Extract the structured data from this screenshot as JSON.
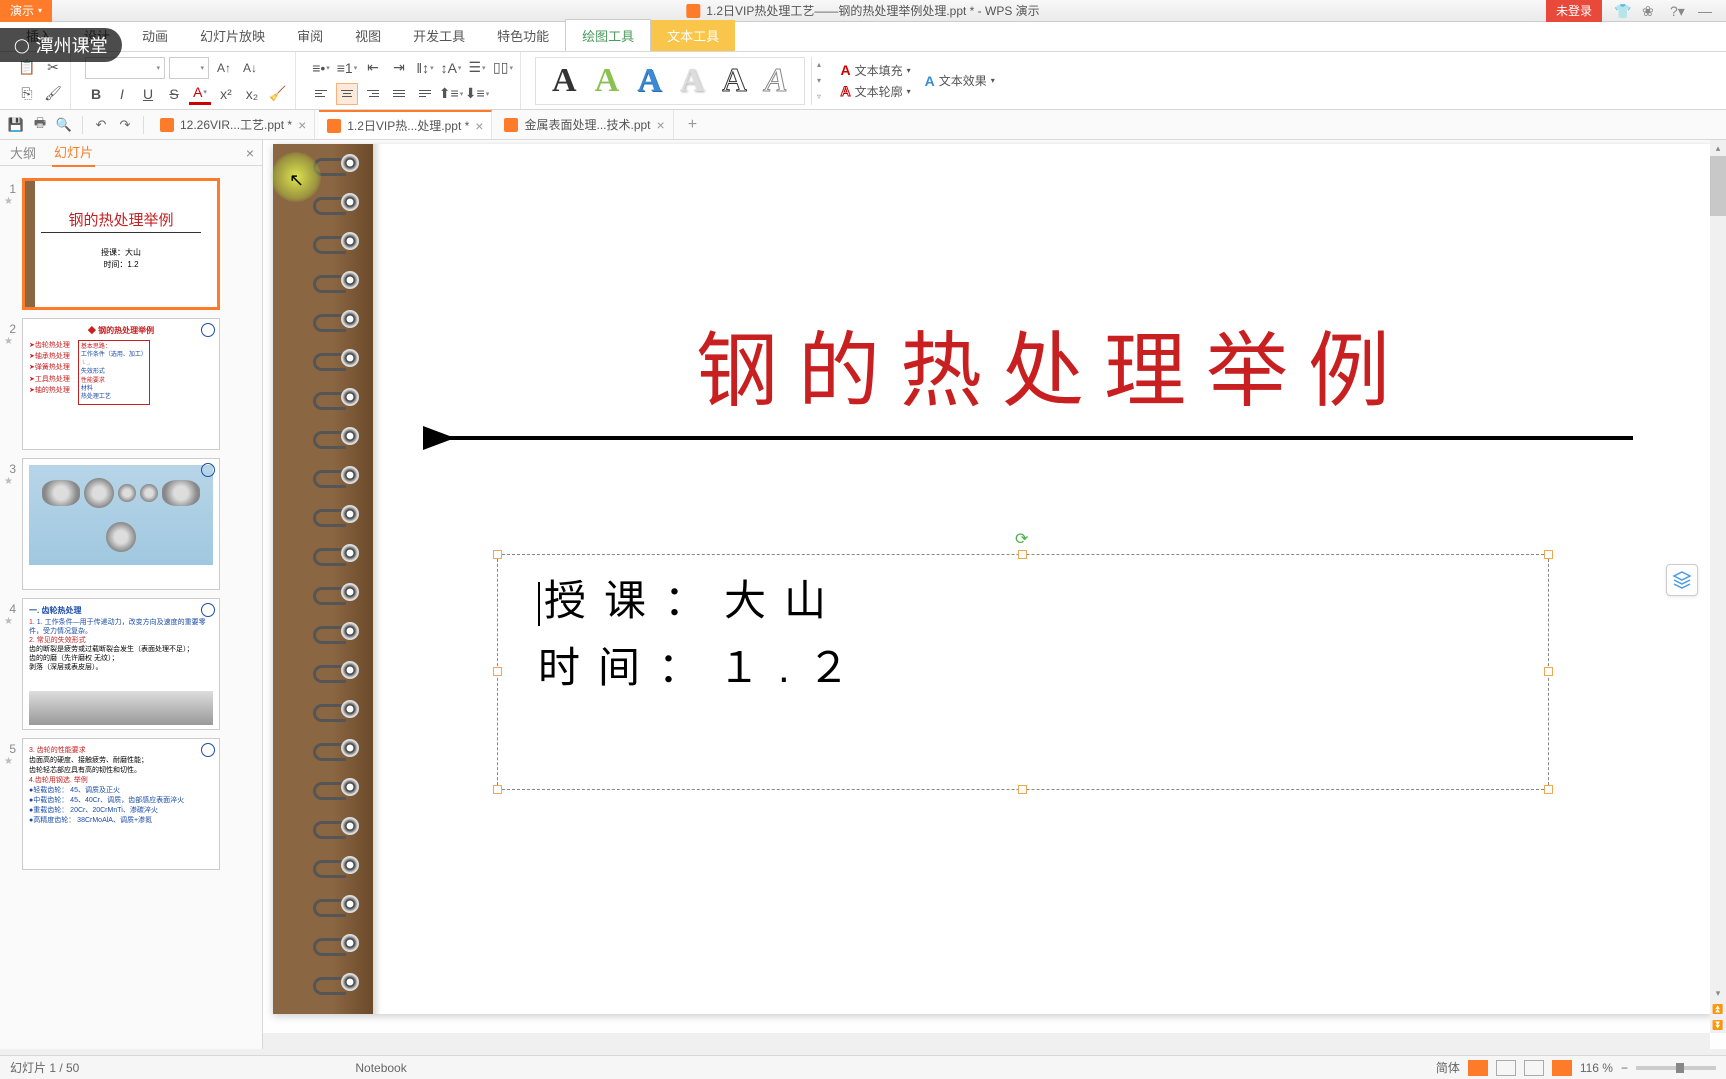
{
  "title_bar": {
    "app_label": "演示",
    "doc_title": "1.2日VIP热处理工艺——钢的热处理举例处理.ppt * - WPS 演示",
    "login_label": "未登录"
  },
  "menu": {
    "items": [
      "插入",
      "设计",
      "动画",
      "幻灯片放映",
      "审阅",
      "视图",
      "开发工具",
      "特色功能"
    ],
    "tool1": "绘图工具",
    "tool2": "文本工具"
  },
  "watermark": "潭州课堂",
  "ribbon": {
    "text_fill": "文本填充",
    "text_outline": "文本轮廓",
    "text_effects": "文本效果"
  },
  "doc_tabs": {
    "t1": "12.26VIR...工艺.ppt *",
    "t2": "1.2日VIP热...处理.ppt *",
    "t3": "金属表面处理...技术.ppt"
  },
  "panel_tabs": {
    "outline": "大纲",
    "slides": "幻灯片"
  },
  "thumbs": {
    "nums": [
      "1",
      "2",
      "3",
      "4",
      "5"
    ],
    "t1_title": "钢的热处理举例",
    "t1_sub1": "授课：大山",
    "t1_sub2": "时间：1.2",
    "t2_title": "◆ 钢的热处理举例",
    "t2_items": [
      "➤齿轮热处理",
      "➤轴承热处理",
      "➤弹簧热处理",
      "➤工具热处理",
      "➤轴的热处理"
    ],
    "t2_side_title": "基本思路：",
    "t2_side": [
      "工作条件（选用、加工）",
      "失效形式",
      "性能要求",
      "材料",
      "热处理工艺"
    ],
    "t4_title": "一. 齿轮热处理",
    "t4_l1": "1. 工作条件—用于传递动力，改变方向及速度的重要零件，受力情况复杂。",
    "t4_l2": "2. 常见的失效形式",
    "t4_l3": "齿的断裂是疲劳或过载断裂会发生（表面处理不足）；",
    "t4_l4": "齿的的磨（先许磨权 无纹）；",
    "t4_l5": "剥落（深层或表皮层）。",
    "t5_title": "3. 齿轮的性能要求",
    "t5_l1": "齿面高的硬度、接触疲劳、耐磨性能；",
    "t5_l2": "齿轮轻芯部应具有高的韧性和切性。",
    "t5_l3": "4.齿轮用钢选. 举例",
    "t5_l4": "●轻载齿轮： 45、调质及正火",
    "t5_l5": "●中载齿轮： 45、40Cr、调质，齿部感应表面淬火",
    "t5_l6": "●重载齿轮： 20Cr、20CrMnTi、渗碳淬火",
    "t5_l7": "●高精度齿轮： 38CrMoAlA、调质+渗氮"
  },
  "slide": {
    "title": "钢的热处理举例",
    "line1_label": "授课：",
    "line1_value": "大山",
    "line2_label": "时间：",
    "line2_value": "１.２"
  },
  "status": {
    "slide_counter": "幻灯片 1 / 50",
    "notebook": "Notebook",
    "lang": "简体",
    "zoom": "116 %"
  }
}
